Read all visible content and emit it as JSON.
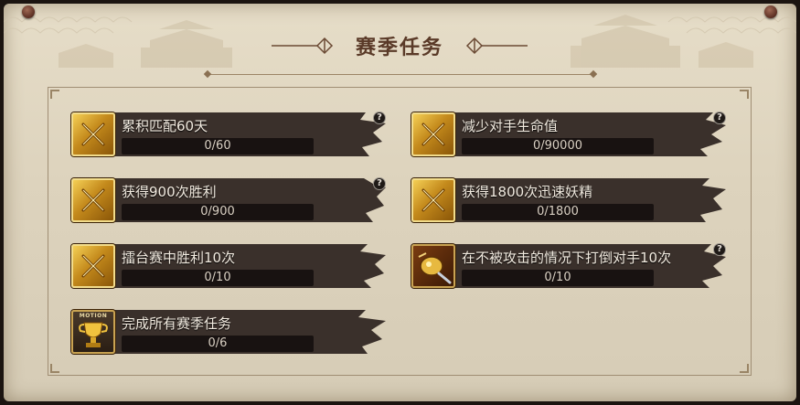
{
  "page": {
    "title": "赛季任务"
  },
  "colors": {
    "accent_gold": "#e0b64c",
    "paper": "#e6ddc8",
    "ink": "#5a3a28"
  },
  "tasks": [
    {
      "title": "累积匹配60天",
      "progress_text": "0/60",
      "progress": 0,
      "icon": "gold-crossed-swords-icon",
      "help": true
    },
    {
      "title": "减少对手生命值",
      "progress_text": "0/90000",
      "progress": 0,
      "icon": "gold-crossed-swords-icon",
      "help": true
    },
    {
      "title": "获得900次胜利",
      "progress_text": "0/900",
      "progress": 0,
      "icon": "gold-crossed-swords-icon",
      "help": true
    },
    {
      "title": "获得1800次迅速妖精",
      "progress_text": "0/1800",
      "progress": 0,
      "icon": "gold-crossed-swords-icon",
      "help": false
    },
    {
      "title": "擂台赛中胜利10次",
      "progress_text": "0/10",
      "progress": 0,
      "icon": "gold-crossed-swords-icon",
      "help": false
    },
    {
      "title": "在不被攻击的情况下打倒对手10次",
      "progress_text": "0/10",
      "progress": 0,
      "icon": "golden-gauntlet-icon",
      "help": true
    },
    {
      "title": "完成所有赛季任务",
      "progress_text": "0/6",
      "progress": 0,
      "icon": "motion-trophy-icon",
      "icon_text": "MOTION",
      "help": false
    }
  ]
}
